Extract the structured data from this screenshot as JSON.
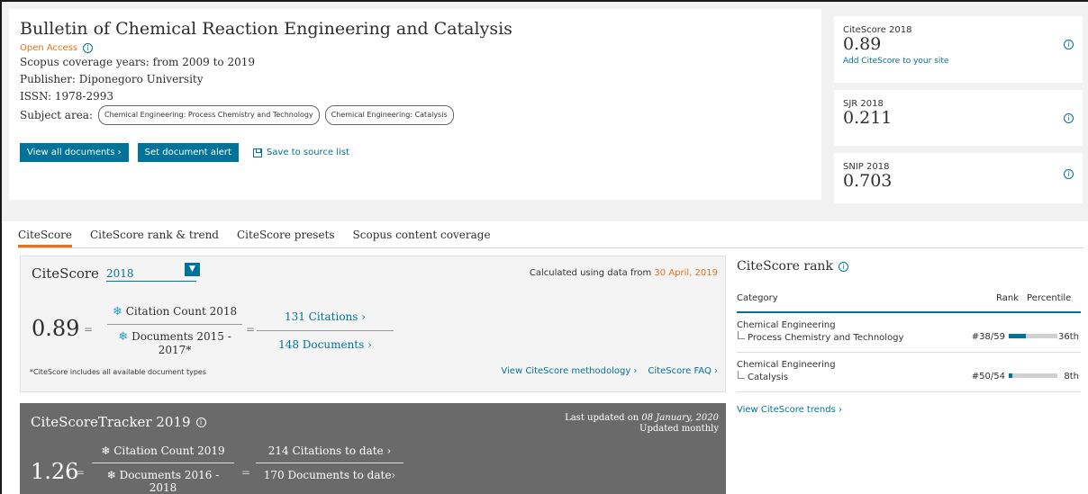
{
  "journal": {
    "title": "Bulletin of Chemical Reaction Engineering and Catalysis",
    "open_access": "Open Access",
    "coverage": "Scopus coverage years:  from 2009 to 2019",
    "publisher": "Publisher:  Diponegoro University",
    "issn": "ISSN:  1978-2993",
    "subject_label": "Subject area:",
    "subjects": [
      "Chemical Engineering: Process Chemistry and Technology",
      "Chemical Engineering: Catalysis"
    ],
    "btn_view_all": "View all documents ›",
    "btn_alert": "Set document alert",
    "save_link": "Save to source list"
  },
  "metrics": [
    {
      "label": "CiteScore 2018",
      "value": "0.89",
      "extra": "Add CiteScore to your site"
    },
    {
      "label": "SJR 2018",
      "value": "0.211"
    },
    {
      "label": "SNIP 2018",
      "value": "0.703"
    }
  ],
  "tabs": [
    "CiteScore",
    "CiteScore rank & trend",
    "CiteScore presets",
    "Scopus content coverage"
  ],
  "citescore": {
    "title": "CiteScore",
    "year": "2018",
    "calc_prefix": "Calculated using data from ",
    "calc_date": "30 April, 2019",
    "value": "0.89",
    "num_label": "Citation Count 2018",
    "den_label": "Documents 2015 - 2017*",
    "num_value": "131 Citations ›",
    "den_value": "148 Documents ›",
    "note": "*CiteScore includes all available document types",
    "link_methodology": "View CiteScore methodology ›",
    "link_faq": "CiteScore FAQ ›"
  },
  "tracker": {
    "title": "CiteScoreTracker 2019",
    "updated_prefix": "Last updated on ",
    "updated_date": "08 January, 2020",
    "updated_freq": "Updated monthly",
    "value": "1.26",
    "num_label": "Citation Count 2019",
    "den_label": "Documents 2016 - 2018",
    "num_value": "214 Citations to date ›",
    "den_value": "170 Documents to date›"
  },
  "rank": {
    "title": "CiteScore rank",
    "col_category": "Category",
    "col_rank": "Rank",
    "col_percentile": "Percentile",
    "rows": [
      {
        "category": "Chemical Engineering",
        "sub": "Process Chemistry and Technology",
        "rank": "#38/59",
        "percentile": "36th",
        "pct_value": 36
      },
      {
        "category": "Chemical Engineering",
        "sub": "Catalysis",
        "rank": "#50/54",
        "percentile": "8th",
        "pct_value": 8
      }
    ],
    "link": "View CiteScore trends ›"
  },
  "colors": {
    "accent": "#007398",
    "orange": "#e9711c",
    "tracker_bg": "#6a6a6a"
  }
}
